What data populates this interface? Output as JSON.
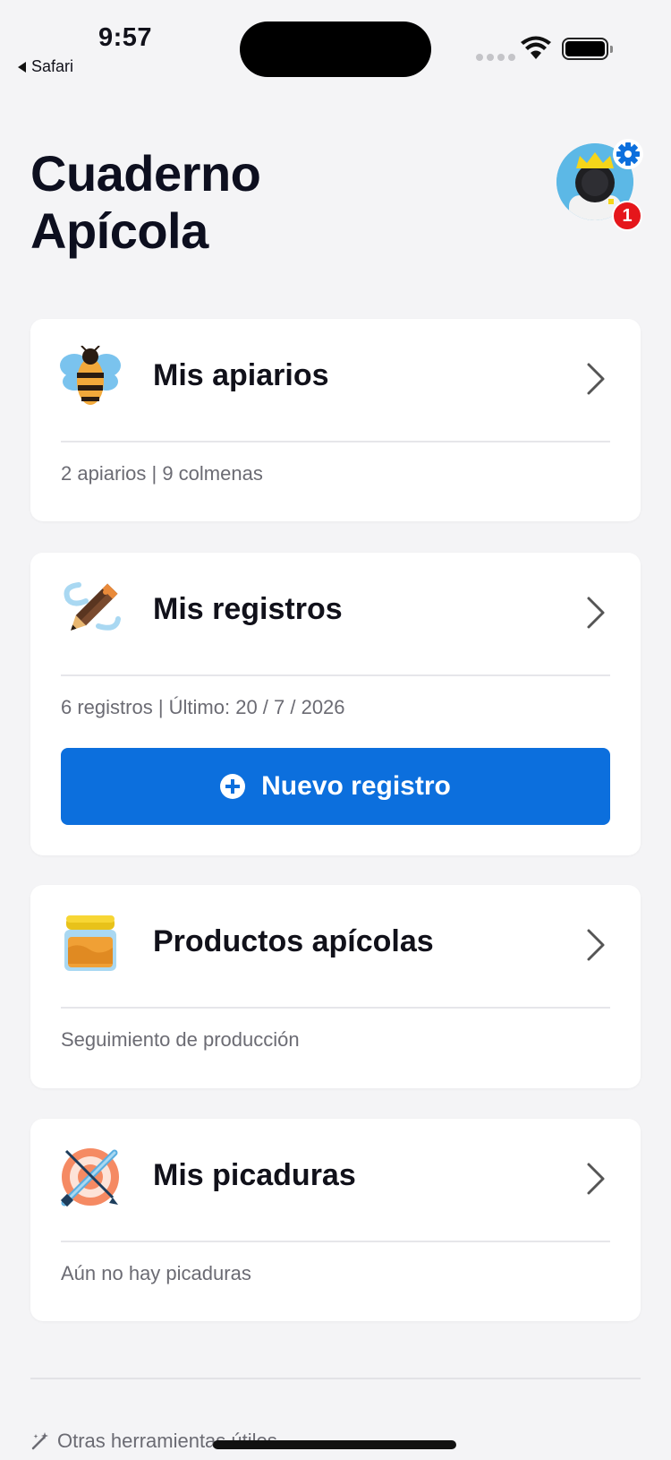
{
  "status_bar": {
    "time": "9:57",
    "back_app": "Safari"
  },
  "header": {
    "title_line1": "Cuaderno",
    "title_line2": "Apícola",
    "notification_count": "1"
  },
  "cards": {
    "apiaries": {
      "title": "Mis apiarios",
      "subtitle": "2 apiarios | 9 colmenas",
      "icon": "bee-icon"
    },
    "records": {
      "title": "Mis registros",
      "subtitle": "6 registros | Último: 20 / 7 / 2026",
      "button_label": "Nuevo registro",
      "icon": "pencil-icon"
    },
    "products": {
      "title": "Productos apícolas",
      "subtitle": "Seguimiento de producción",
      "icon": "honey-jar-icon"
    },
    "stings": {
      "title": "Mis picaduras",
      "subtitle": "Aún no hay picaduras",
      "icon": "target-sword-icon"
    }
  },
  "footer": {
    "tools_label": "Otras herramientas útiles"
  },
  "colors": {
    "accent": "#0c6fdd",
    "badge": "#e5161b",
    "background": "#f4f4f6"
  }
}
